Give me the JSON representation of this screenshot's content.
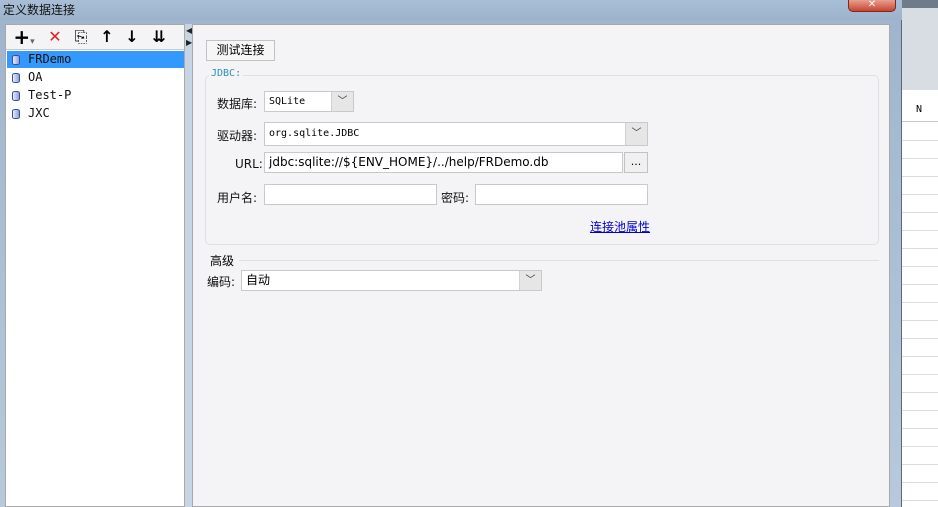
{
  "window": {
    "title": "定义数据连接",
    "close_glyph": "✕"
  },
  "toolbar": {
    "add_glyph": "+",
    "add_dropdown_glyph": "▾",
    "delete_glyph": "✕",
    "copy_glyph": "⎘",
    "up_glyph": "↑",
    "down_glyph": "↓",
    "sort_glyph": "⇊"
  },
  "connections": [
    {
      "label": "FRDemo",
      "selected": true
    },
    {
      "label": "OA",
      "selected": false
    },
    {
      "label": "Test-P",
      "selected": false
    },
    {
      "label": "JXC",
      "selected": false
    }
  ],
  "form": {
    "test_button": "测试连接",
    "jdbc_legend": "JDBC:",
    "database_label": "数据库:",
    "database_value": "SQLite",
    "driver_label": "驱动器:",
    "driver_value": "org.sqlite.JDBC",
    "url_label": "URL:",
    "url_value": "jdbc:sqlite://${ENV_HOME}/../help/FRDemo.db",
    "browse_label": "...",
    "username_label": "用户名:",
    "username_value": "",
    "password_label": "密码:",
    "password_value": "",
    "pool_link": "连接池属性"
  },
  "advanced": {
    "title": "高级",
    "encoding_label": "编码:",
    "encoding_value": "自动"
  },
  "background_app": {
    "column_header": "N"
  },
  "colors": {
    "selection": "#3399ff",
    "legend": "#2a8fb8",
    "link": "#0000cc"
  }
}
